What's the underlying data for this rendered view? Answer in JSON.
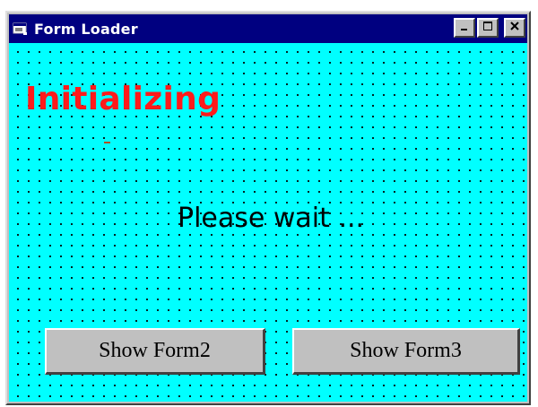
{
  "window": {
    "title": "Form Loader",
    "icon": "app-window-icon",
    "controls": [
      "minimize-icon",
      "maximize-icon",
      "close-icon"
    ]
  },
  "form": {
    "background_color": "#00ffff",
    "status_heading": "Initializing",
    "status_heading_color": "#ff1a1a",
    "wait_message": "Please wait ..."
  },
  "buttons": {
    "show_form2": "Show Form2",
    "show_form3": "Show Form3"
  }
}
